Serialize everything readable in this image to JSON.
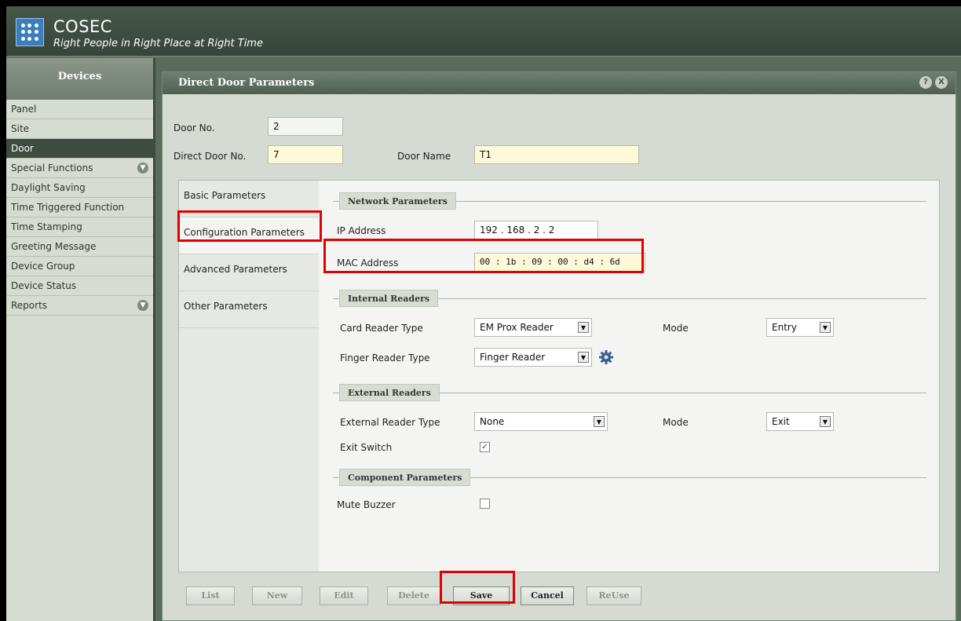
{
  "header": {
    "title": "COSEC",
    "tagline": "Right People in Right Place at Right Time"
  },
  "sidebar": {
    "title": "Devices",
    "items": [
      {
        "label": "Panel"
      },
      {
        "label": "Site"
      },
      {
        "label": "Door",
        "active": true
      },
      {
        "label": "Special Functions",
        "expandable": true
      },
      {
        "label": "Daylight Saving"
      },
      {
        "label": "Time Triggered Function"
      },
      {
        "label": "Time Stamping"
      },
      {
        "label": "Greeting Message"
      },
      {
        "label": "Device Group"
      },
      {
        "label": "Device Status"
      },
      {
        "label": "Reports",
        "expandable": true
      }
    ]
  },
  "panel": {
    "title": "Direct Door Parameters",
    "help_icon": "?",
    "close_icon": "X",
    "door_no_label": "Door No.",
    "door_no_value": "2",
    "direct_door_no_label": "Direct Door No.",
    "direct_door_no_value": "7",
    "door_name_label": "Door Name",
    "door_name_value": "T1"
  },
  "tabs": [
    {
      "label": "Basic Parameters"
    },
    {
      "label": "Configuration Parameters",
      "active": true
    },
    {
      "label": "Advanced Parameters"
    },
    {
      "label": "Other Parameters"
    }
  ],
  "network": {
    "title": "Network Parameters",
    "ip_label": "IP Address",
    "ip_value": "192 . 168 . 2   . 2",
    "mac_label": "MAC Address",
    "mac_value": "00 : 1b : 09 : 00 : d4 : 6d"
  },
  "internal": {
    "title": "Internal Readers",
    "card_label": "Card Reader Type",
    "card_value": "EM Prox Reader",
    "mode_label": "Mode",
    "mode_value": "Entry",
    "finger_label": "Finger Reader Type",
    "finger_value": "Finger Reader"
  },
  "external": {
    "title": "External Readers",
    "type_label": "External Reader Type",
    "type_value": "None",
    "mode_label": "Mode",
    "mode_value": "Exit",
    "exit_switch_label": "Exit Switch",
    "exit_switch_checked": true
  },
  "component": {
    "title": "Component Parameters",
    "mute_label": "Mute Buzzer",
    "mute_checked": false
  },
  "buttons": {
    "list": "List",
    "new": "New",
    "edit": "Edit",
    "delete": "Delete",
    "save": "Save",
    "cancel": "Cancel",
    "reuse": "ReUse"
  },
  "colors": {
    "highlight": "#e00000",
    "header": "#3e4b40",
    "field_yellow": "#fdf9d9"
  }
}
